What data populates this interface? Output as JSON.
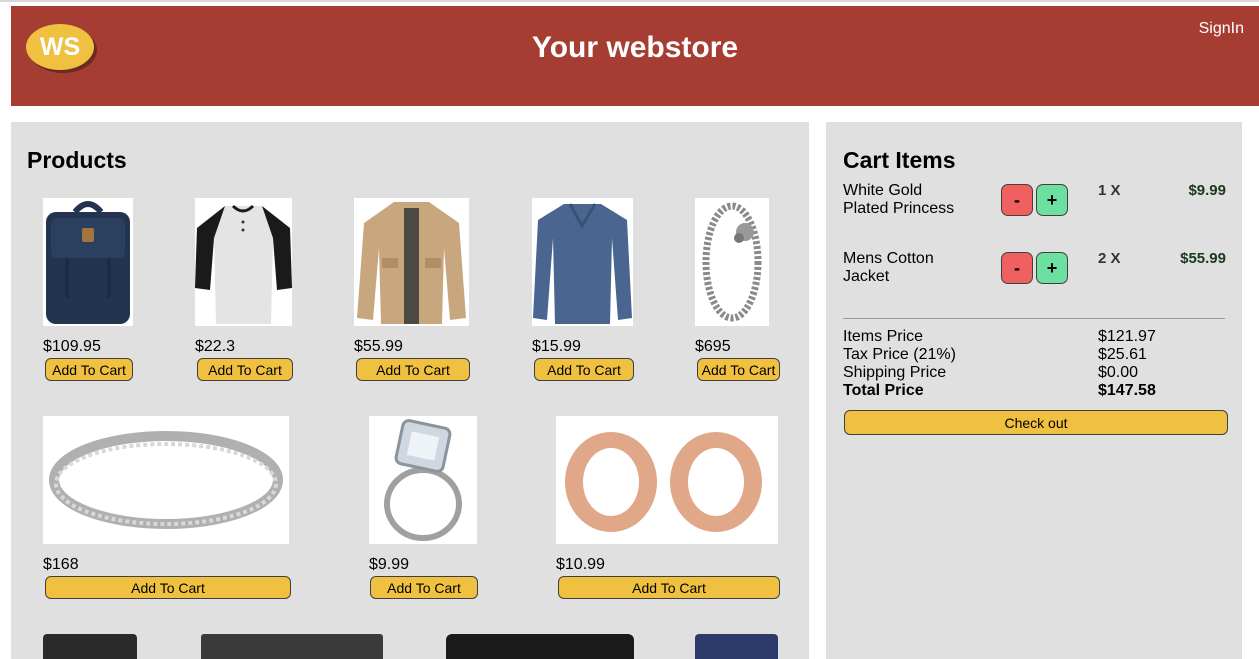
{
  "header": {
    "logo_text": "WS",
    "title": "Your webstore",
    "signin_label": "SignIn"
  },
  "products": {
    "heading": "Products",
    "add_label": "Add To Cart",
    "items": [
      {
        "price": "$109.95",
        "image": "backpack-image"
      },
      {
        "price": "$22.3",
        "image": "raglan-tshirt-image"
      },
      {
        "price": "$55.99",
        "image": "cotton-jacket-image"
      },
      {
        "price": "$15.99",
        "image": "long-sleeve-shirt-image"
      },
      {
        "price": "$695",
        "image": "dragon-bracelet-image"
      },
      {
        "price": "$168",
        "image": "diamond-band-ring-image"
      },
      {
        "price": "$9.99",
        "image": "princess-ring-image"
      },
      {
        "price": "$10.99",
        "image": "rose-gold-tunnel-image"
      }
    ]
  },
  "cart": {
    "heading": "Cart Items",
    "minus_label": "-",
    "plus_label": "+",
    "items": [
      {
        "name_line1": "White Gold",
        "name_line2": "Plated Princess",
        "qty": "1 X",
        "price": "$9.99"
      },
      {
        "name_line1": "Mens Cotton",
        "name_line2": "Jacket",
        "qty": "2 X",
        "price": "$55.99"
      }
    ],
    "summary": {
      "items_label": "Items Price",
      "items_value": "$121.97",
      "tax_label": "Tax Price (21%)",
      "tax_value": "$25.61",
      "shipping_label": "Shipping Price",
      "shipping_value": "$0.00",
      "total_label": "Total Price",
      "total_value": "$147.58"
    },
    "checkout_label": "Check out"
  },
  "colors": {
    "header": "#a63d32",
    "button": "#f0c040",
    "minus": "#f06060",
    "plus": "#6ce0a0",
    "panel": "#e0e0e0"
  }
}
